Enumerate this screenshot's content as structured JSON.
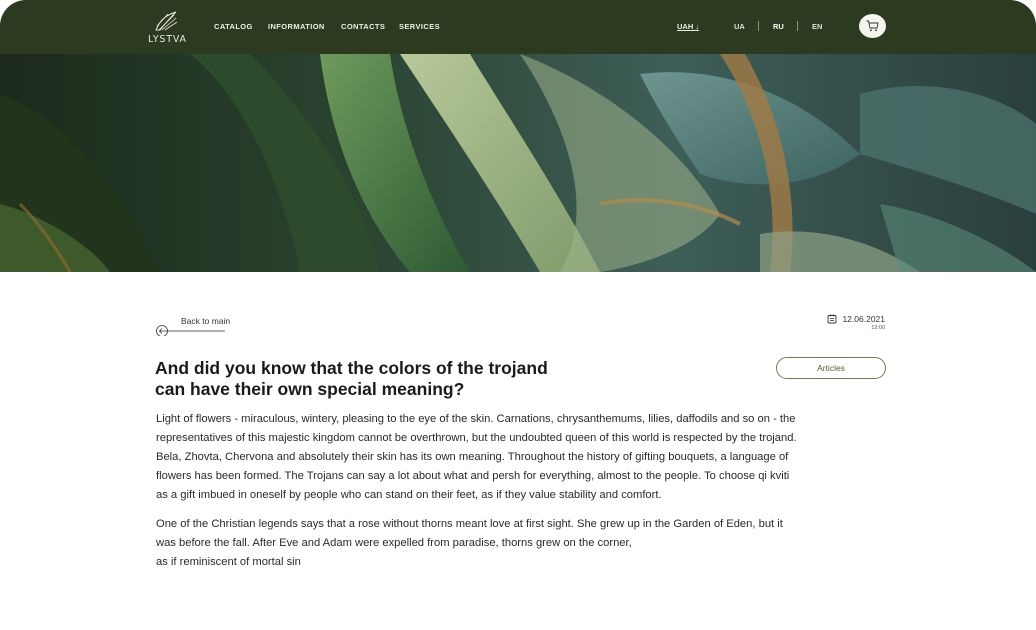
{
  "header": {
    "logo_text": "LYSTVA",
    "nav": [
      "CATALOG",
      "INFORMATION",
      "CONTACTS",
      "SERVICES"
    ],
    "currency": "UAH ↓",
    "languages": [
      "UA",
      "RU",
      "EN"
    ],
    "active_language": "RU",
    "colors": {
      "bar": "#2c3a1f"
    }
  },
  "hero": {
    "image": "green-leaves-banner"
  },
  "article": {
    "back_label": "Back to main",
    "date": "12.06.2021",
    "time": "12:00",
    "title_lines": [
      "And did you know that the colors of the trojand",
      "can have their own special meaning?"
    ],
    "category": "Articles",
    "paragraph1_lines": [
      "Light of flowers - miraculous, wintery, pleasing to the eye of the skin. Carnations, chrysanthemums, lilies, daffodils and so on - the",
      "representatives of this majestic kingdom cannot be overthrown, but the undoubted queen of this world is respected by the trojand.",
      "Bela, Zhovta, Chervona and absolutely their skin has its own meaning. Throughout the history of gifting bouquets, a language of",
      "flowers has been formed. The Trojans can say a lot about what and persh for everything, almost to the people. To choose qi kviti",
      "as a gift imbued in oneself by people who can stand on their feet, as if they value stability and comfort."
    ],
    "paragraph2_lines": [
      "One of the Christian legends says that a rose without thorns meant love at first sight. She grew up in the Garden of Eden, but it",
      "was before the fall. After Eve and Adam were expelled from paradise, thorns grew on the corner,",
      "as if reminiscent of mortal sin"
    ]
  }
}
